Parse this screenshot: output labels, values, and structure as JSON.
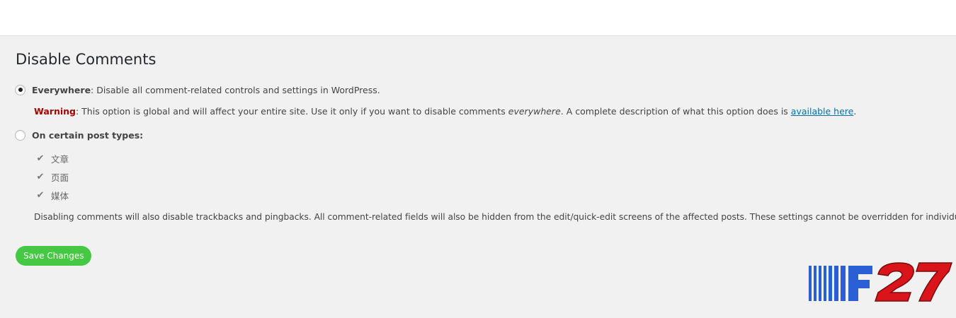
{
  "page": {
    "title": "Disable Comments"
  },
  "options": {
    "everywhere": {
      "label": "Everywhere",
      "description": ": Disable all comment-related controls and settings in WordPress.",
      "checked": true
    },
    "warning": {
      "label": "Warning",
      "text_before": ": This option is global and will affect your entire site. Use it only if you want to disable comments ",
      "emphasis": "everywhere",
      "text_after": ". A complete description of what this option does is ",
      "link_text": "available here",
      "end": "."
    },
    "post_types": {
      "label": "On certain post types",
      "suffix": ":",
      "checked": false,
      "items": [
        {
          "label": "文章",
          "checked": true
        },
        {
          "label": "页面",
          "checked": true
        },
        {
          "label": "媒体",
          "checked": true
        }
      ]
    }
  },
  "note": "Disabling comments will also disable trackbacks and pingbacks. All comment-related fields will also be hidden from the edit/quick-edit screens of the affected posts. These settings cannot be overridden for individual posts.",
  "buttons": {
    "save_label": "Save Changes"
  },
  "logo": {
    "text": "F27",
    "colors": {
      "bars": "#2a5fd6",
      "letters": "#d9141a"
    }
  },
  "colors": {
    "accent_button": "#45c944",
    "warning": "#aa0000",
    "link": "#0073aa",
    "panel_background": "#f1f1f1"
  }
}
